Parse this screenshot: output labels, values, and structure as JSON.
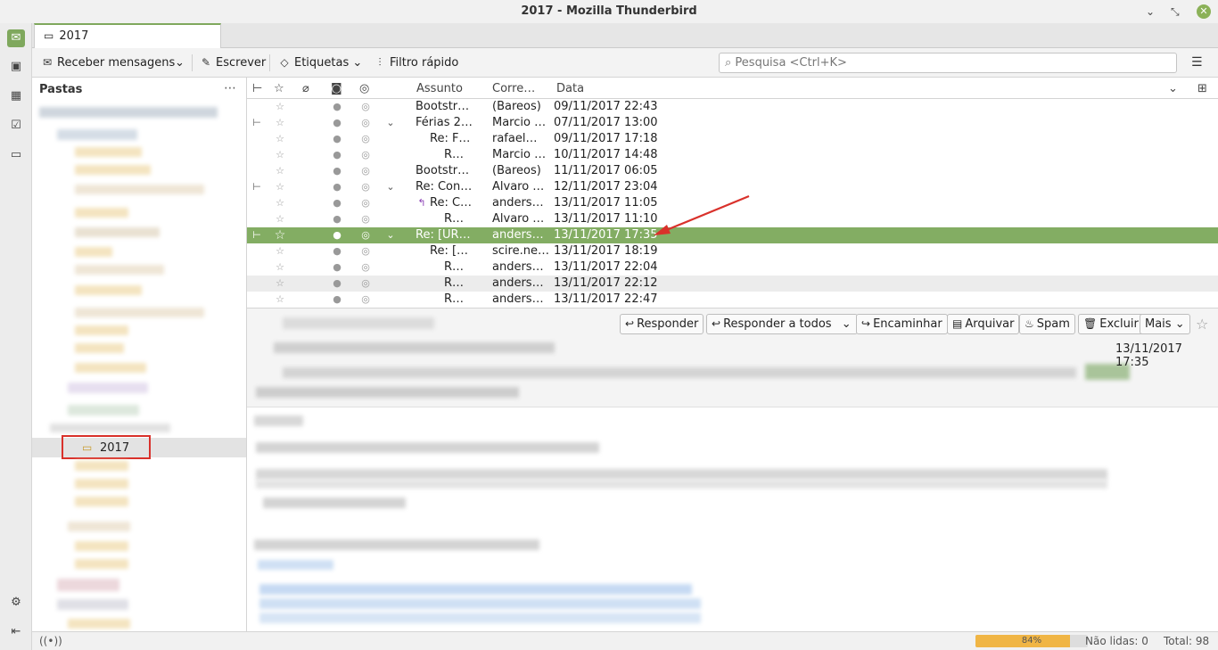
{
  "window": {
    "title": "2017 - Mozilla Thunderbird",
    "min_icon": "minimize-icon",
    "max_icon": "maximize-icon",
    "close_icon": "close-icon"
  },
  "spaces": [
    "mail-icon",
    "address-book-icon",
    "calendar-icon",
    "tasks-icon",
    "chat-icon",
    "settings-icon",
    "collapse-icon"
  ],
  "tab": {
    "label": "2017"
  },
  "toolbar": {
    "get_messages": "Receber mensagens",
    "write": "Escrever",
    "tags": "Etiquetas",
    "quick_filter": "Filtro rápido",
    "search_placeholder": "Pesquisa <Ctrl+K>"
  },
  "folders": {
    "header": "Pastas",
    "more": "⋯",
    "selected": "2017"
  },
  "thread_columns": {
    "subject": "Assunto",
    "correspondent": "Corre…",
    "date": "Data"
  },
  "messages": [
    {
      "subject": "Bootstr…",
      "from": "(Bareos)",
      "date": "09/11/2017 22:43"
    },
    {
      "subject": "Férias 2…",
      "from": "Marcio …",
      "date": "07/11/2017 13:00"
    },
    {
      "subject": "Re: F…",
      "from": "rafael…",
      "date": "09/11/2017 17:18"
    },
    {
      "subject": "R…",
      "from": "Marcio …",
      "date": "10/11/2017 14:48"
    },
    {
      "subject": "Bootstr…",
      "from": "(Bareos)",
      "date": "11/11/2017 06:05"
    },
    {
      "subject": "Re: Con…",
      "from": "Alvaro …",
      "date": "12/11/2017 23:04"
    },
    {
      "subject": "Re: C…",
      "from": "anders…",
      "date": "13/11/2017 11:05"
    },
    {
      "subject": "R…",
      "from": "Alvaro …",
      "date": "13/11/2017 11:10"
    },
    {
      "subject": "Re: [UR…",
      "from": "anders…",
      "date": "13/11/2017 17:35"
    },
    {
      "subject": "Re: […",
      "from": "scire.ne…",
      "date": "13/11/2017 18:19"
    },
    {
      "subject": "R…",
      "from": "anders…",
      "date": "13/11/2017 22:04"
    },
    {
      "subject": "R…",
      "from": "anders…",
      "date": "13/11/2017 22:12"
    },
    {
      "subject": "R…",
      "from": "anders…",
      "date": "13/11/2017 22:47"
    }
  ],
  "header_buttons": {
    "reply": "Responder",
    "reply_all": "Responder a todos",
    "forward": "Encaminhar",
    "archive": "Arquivar",
    "spam": "Spam",
    "delete": "Excluir",
    "more": "Mais"
  },
  "message_date": "13/11/2017 17:35",
  "status": {
    "quota": "84%",
    "quota_value": 0.84,
    "unread": "Não lidas: 0",
    "total": "Total: 98"
  },
  "colors": {
    "accent": "#83ad63",
    "highlight": "#d9312b"
  }
}
